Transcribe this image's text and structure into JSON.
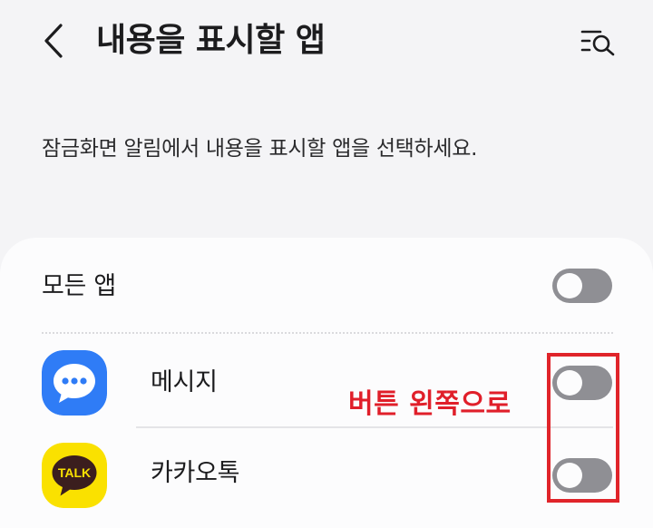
{
  "header": {
    "title": "내용을 표시할 앱",
    "back_icon": "chevron-left-icon",
    "search_icon": "search-filter-icon"
  },
  "description": "잠금화면 알림에서 내용을 표시할 앱을 선택하세요.",
  "all_apps": {
    "label": "모든 앱",
    "enabled": false
  },
  "apps": [
    {
      "name": "메시지",
      "icon": "messages-app-icon",
      "enabled": false
    },
    {
      "name": "카카오톡",
      "icon": "kakaotalk-app-icon",
      "icon_text": "TALK",
      "enabled": false
    }
  ],
  "annotation": {
    "text": "버튼 왼쪽으로",
    "color": "#e01f2a"
  },
  "colors": {
    "background": "#f4f4f6",
    "card": "#fcfcfd",
    "toggle_off": "#8f8f94",
    "messages_blue": "#2f7cf6",
    "kakao_yellow": "#fae100"
  }
}
